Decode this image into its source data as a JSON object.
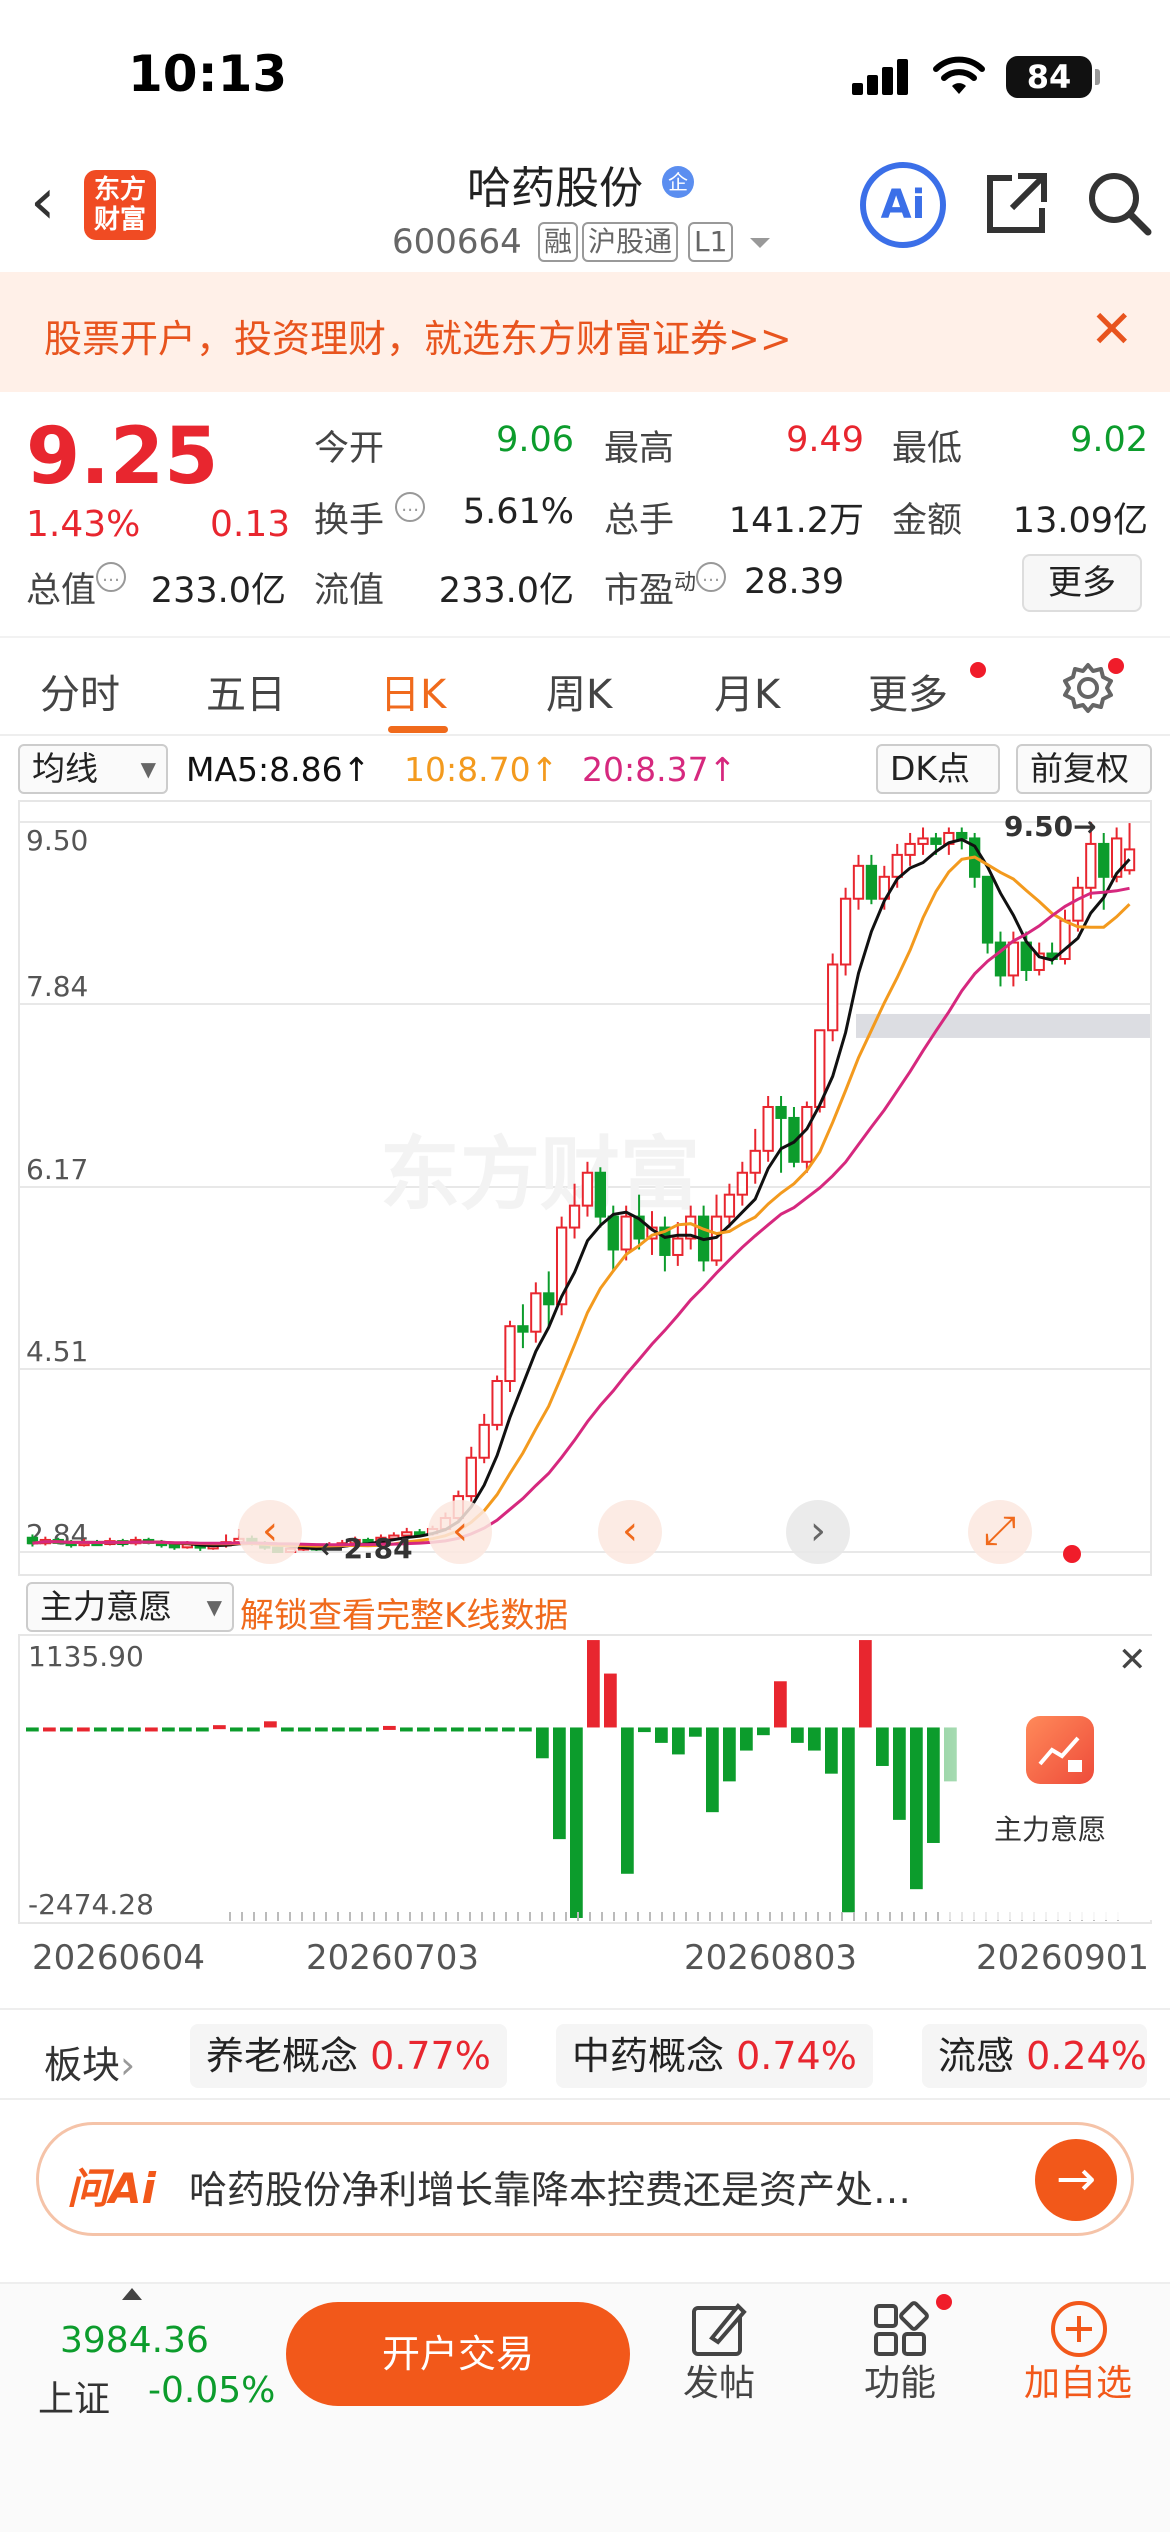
{
  "status": {
    "time": "10:13",
    "battery": "84"
  },
  "nav": {
    "logo": "东方财富",
    "title": "哈药股份",
    "title_badge": "企",
    "code": "600664",
    "tags": [
      "融",
      "沪股通",
      "L1"
    ],
    "ai_label": "Ai"
  },
  "banner": {
    "text": "股票开户，投资理财，就选东方财富证券>>",
    "close": "✕"
  },
  "quote": {
    "price": "9.25",
    "change_pct": "1.43%",
    "change_abs": "0.13",
    "open_label": "今开",
    "open": "9.06",
    "high_label": "最高",
    "high": "9.49",
    "low_label": "最低",
    "low": "9.02",
    "turnover_label": "换手",
    "turnover": "5.61%",
    "volume_label": "总手",
    "volume": "141.2万",
    "amount_label": "金额",
    "amount": "13.09亿",
    "mktcap_label": "总值",
    "mktcap": "233.0亿",
    "float_label": "流值",
    "float": "233.0亿",
    "pe_label": "市盈",
    "pe_sup": "动",
    "pe": "28.39",
    "more": "更多"
  },
  "tabs": [
    "分时",
    "五日",
    "日K",
    "周K",
    "月K",
    "更多"
  ],
  "ma_bar": {
    "selector": "均线",
    "ma5": "MA5:8.86↑",
    "ma10": "10:8.70↑",
    "ma20": "20:8.37↑",
    "dk": "DK点",
    "adjust": "前复权"
  },
  "chart_data": {
    "type": "candlestick",
    "y_labels": [
      "9.50",
      "7.84",
      "6.17",
      "4.51",
      "2.84"
    ],
    "ylim": [
      2.84,
      9.5
    ],
    "max_annotation": "9.50→",
    "min_annotation": "←2.84",
    "watermark": "东方财富",
    "candles": [
      [
        2.97,
        2.92,
        3.0,
        2.89
      ],
      [
        2.92,
        2.95,
        2.98,
        2.9
      ],
      [
        2.95,
        2.93,
        2.97,
        2.91
      ],
      [
        2.93,
        2.91,
        2.95,
        2.88
      ],
      [
        2.91,
        2.93,
        2.96,
        2.89
      ],
      [
        2.93,
        2.92,
        2.95,
        2.9
      ],
      [
        2.92,
        2.94,
        2.97,
        2.9
      ],
      [
        2.94,
        2.92,
        2.96,
        2.89
      ],
      [
        2.92,
        2.95,
        2.98,
        2.9
      ],
      [
        2.95,
        2.93,
        2.97,
        2.91
      ],
      [
        2.93,
        2.91,
        2.95,
        2.88
      ],
      [
        2.91,
        2.89,
        2.93,
        2.86
      ],
      [
        2.89,
        2.91,
        2.94,
        2.87
      ],
      [
        2.91,
        2.88,
        2.93,
        2.85
      ],
      [
        2.88,
        2.9,
        2.92,
        2.86
      ],
      [
        2.9,
        2.93,
        3.0,
        2.88
      ],
      [
        2.93,
        2.96,
        3.05,
        2.91
      ],
      [
        2.96,
        2.92,
        2.99,
        2.9
      ],
      [
        2.92,
        2.88,
        2.94,
        2.86
      ],
      [
        2.88,
        2.84,
        2.9,
        2.84
      ],
      [
        2.84,
        2.87,
        2.9,
        2.84
      ],
      [
        2.87,
        2.89,
        2.92,
        2.85
      ],
      [
        2.89,
        2.87,
        2.91,
        2.85
      ],
      [
        2.87,
        2.9,
        2.93,
        2.86
      ],
      [
        2.9,
        2.92,
        2.95,
        2.88
      ],
      [
        2.92,
        2.95,
        2.98,
        2.9
      ],
      [
        2.95,
        2.93,
        2.97,
        2.91
      ],
      [
        2.93,
        2.97,
        3.0,
        2.91
      ],
      [
        2.97,
        2.99,
        3.02,
        2.95
      ],
      [
        2.99,
        3.02,
        3.06,
        2.97
      ],
      [
        3.02,
        3.01,
        3.05,
        2.99
      ],
      [
        3.01,
        3.05,
        3.08,
        2.99
      ],
      [
        3.05,
        3.15,
        3.2,
        3.03
      ],
      [
        3.15,
        3.35,
        3.4,
        3.12
      ],
      [
        3.35,
        3.7,
        3.8,
        3.3
      ],
      [
        3.7,
        4.0,
        4.1,
        3.65
      ],
      [
        4.0,
        4.4,
        4.45,
        3.95
      ],
      [
        4.4,
        4.9,
        4.95,
        4.3
      ],
      [
        4.9,
        4.85,
        5.1,
        4.7
      ],
      [
        4.85,
        5.2,
        5.3,
        4.75
      ],
      [
        5.2,
        5.1,
        5.4,
        4.9
      ],
      [
        5.1,
        5.8,
        5.9,
        5.0
      ],
      [
        5.8,
        6.0,
        6.2,
        5.7
      ],
      [
        6.0,
        6.3,
        6.4,
        5.9
      ],
      [
        6.3,
        5.9,
        6.35,
        5.8
      ],
      [
        5.9,
        5.6,
        6.0,
        5.4
      ],
      [
        5.6,
        5.9,
        6.0,
        5.5
      ],
      [
        5.9,
        5.7,
        6.1,
        5.6
      ],
      [
        5.7,
        5.8,
        5.95,
        5.55
      ],
      [
        5.8,
        5.55,
        5.9,
        5.4
      ],
      [
        5.55,
        5.7,
        5.85,
        5.45
      ],
      [
        5.7,
        5.9,
        6.0,
        5.6
      ],
      [
        5.9,
        5.5,
        6.0,
        5.4
      ],
      [
        5.5,
        5.9,
        6.1,
        5.45
      ],
      [
        5.9,
        6.1,
        6.2,
        5.8
      ],
      [
        6.1,
        6.3,
        6.4,
        6.0
      ],
      [
        6.3,
        6.5,
        6.7,
        6.2
      ],
      [
        6.5,
        6.9,
        7.0,
        6.4
      ],
      [
        6.9,
        6.8,
        7.0,
        6.3
      ],
      [
        6.8,
        6.4,
        6.9,
        6.35
      ],
      [
        6.4,
        6.9,
        6.95,
        6.3
      ],
      [
        6.9,
        7.6,
        7.6,
        6.85
      ],
      [
        7.6,
        8.2,
        8.3,
        7.5
      ],
      [
        8.2,
        8.8,
        8.9,
        8.1
      ],
      [
        8.8,
        9.1,
        9.2,
        8.7
      ],
      [
        9.1,
        8.8,
        9.2,
        8.75
      ],
      [
        8.8,
        9.0,
        9.1,
        8.7
      ],
      [
        9.0,
        9.2,
        9.3,
        8.9
      ],
      [
        9.2,
        9.3,
        9.4,
        9.1
      ],
      [
        9.3,
        9.35,
        9.45,
        9.2
      ],
      [
        9.35,
        9.3,
        9.4,
        9.2
      ],
      [
        9.3,
        9.4,
        9.45,
        9.2
      ],
      [
        9.4,
        9.35,
        9.45,
        9.25
      ],
      [
        9.35,
        9.0,
        9.4,
        8.9
      ],
      [
        9.0,
        8.4,
        9.0,
        8.3
      ],
      [
        8.4,
        8.1,
        8.5,
        8.0
      ],
      [
        8.1,
        8.4,
        8.5,
        8.0
      ],
      [
        8.4,
        8.15,
        8.5,
        8.05
      ],
      [
        8.15,
        8.3,
        8.4,
        8.1
      ],
      [
        8.3,
        8.25,
        8.4,
        8.2
      ],
      [
        8.25,
        8.6,
        8.7,
        8.2
      ],
      [
        8.6,
        8.9,
        9.0,
        8.5
      ],
      [
        8.9,
        9.3,
        9.5,
        8.8
      ],
      [
        9.3,
        9.0,
        9.4,
        8.7
      ],
      [
        9.0,
        9.35,
        9.45,
        8.95
      ],
      [
        9.06,
        9.25,
        9.49,
        9.02
      ]
    ]
  },
  "lower": {
    "selector": "主力意愿",
    "unlock_text": "解锁查看完整K线数据",
    "max_label": "1135.90",
    "min_label": "-2474.28",
    "feature_label": "主力意愿",
    "dates": [
      "20260604",
      "20260703",
      "20260803",
      "20260901"
    ]
  },
  "sectors": {
    "label": "板块",
    "items": [
      {
        "name": "养老概念",
        "pct": "0.77%"
      },
      {
        "name": "中药概念",
        "pct": "0.74%"
      },
      {
        "name": "流感",
        "pct": "0.24%"
      }
    ]
  },
  "askai": {
    "logo": "问Ai",
    "question": "哈药股份净利增长靠降本控费还是资产处…"
  },
  "bottom": {
    "index_value": "3984.36",
    "index_name": "上证",
    "index_change": "-0.05%",
    "open_trade": "开户交易",
    "post": "发帖",
    "functions": "功能",
    "add_watch": "加自选"
  },
  "colors": {
    "up": "#e8262f",
    "down": "#0c9c2c",
    "accent": "#f06a1c",
    "ma5": "#111111",
    "ma10": "#f39a1e",
    "ma20": "#d6287e"
  }
}
